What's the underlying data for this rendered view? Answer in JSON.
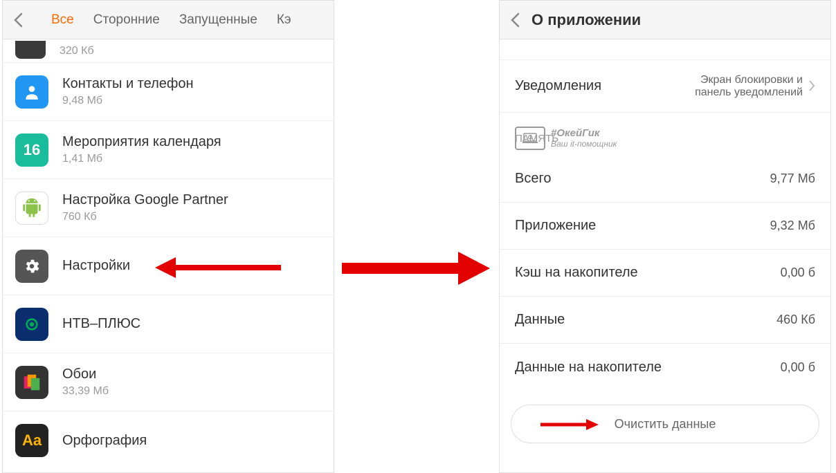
{
  "left": {
    "tabs": [
      "Все",
      "Сторонние",
      "Запущенные",
      "Кэ"
    ],
    "active_tab": 0,
    "apps": [
      {
        "name": "",
        "size": "320 Кб",
        "icon": "dark",
        "partial": true
      },
      {
        "name": "Контакты и телефон",
        "size": "9,48 Мб",
        "icon": "blue"
      },
      {
        "name": "Мероприятия календаря",
        "size": "1,41 Мб",
        "icon": "teal",
        "icon_text": "16"
      },
      {
        "name": "Настройка Google Partner",
        "size": "760 Кб",
        "icon": "android"
      },
      {
        "name": "Настройки",
        "size": "",
        "icon": "gear",
        "highlight": true
      },
      {
        "name": "НТВ–ПЛЮС",
        "size": "",
        "icon": "ntv"
      },
      {
        "name": "Обои",
        "size": "33,39 Мб",
        "icon": "wall"
      },
      {
        "name": "Орфография",
        "size": "",
        "icon": "aa",
        "icon_text": "Aa"
      }
    ]
  },
  "right": {
    "title": "О приложении",
    "notifications": {
      "label": "Уведомления",
      "value": "Экран блокировки и панель уведомлений"
    },
    "memory_section": "ПАМЯТЬ",
    "rows": [
      {
        "label": "Всего",
        "value": "9,77 Мб"
      },
      {
        "label": "Приложение",
        "value": "9,32 Мб"
      },
      {
        "label": "Кэш на накопителе",
        "value": "0,00 б"
      },
      {
        "label": "Данные",
        "value": "460 Кб"
      },
      {
        "label": "Данные на накопителе",
        "value": "0,00 б"
      }
    ],
    "clear_button": "Очистить данные"
  },
  "watermark": {
    "title": "#ОкейГик",
    "sub": "Ваш it-помощник"
  }
}
